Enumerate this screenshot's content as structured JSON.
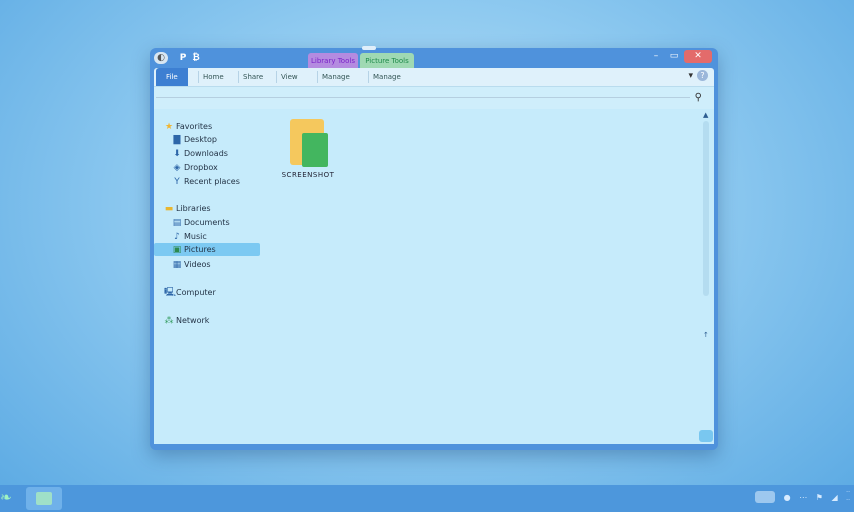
{
  "window": {
    "ribbon_tabs": [
      "File",
      "Home",
      "Share",
      "View",
      "Manage",
      "Manage"
    ],
    "contextual_tabs": [
      "Library Tools",
      "Picture Tools"
    ],
    "controls": {
      "minimize": "–",
      "maximize": "▭",
      "close": "✕"
    }
  },
  "nav": {
    "favorites": {
      "label": "Favorites",
      "items": [
        "Desktop",
        "Downloads",
        "Dropbox",
        "Recent places"
      ]
    },
    "libraries": {
      "label": "Libraries",
      "items": [
        "Documents",
        "Music",
        "Pictures",
        "Videos"
      ],
      "selected": "Pictures"
    },
    "computer": "Computer",
    "network": "Network"
  },
  "files": [
    {
      "name": "SCREENSHOT",
      "type": "folder"
    }
  ],
  "colors": {
    "accent": "#3d7fd2",
    "window_frame": "#4f92dc",
    "content_bg": "#c6ebfb",
    "selection": "#7cc9f2",
    "close": "#e36b6b"
  }
}
